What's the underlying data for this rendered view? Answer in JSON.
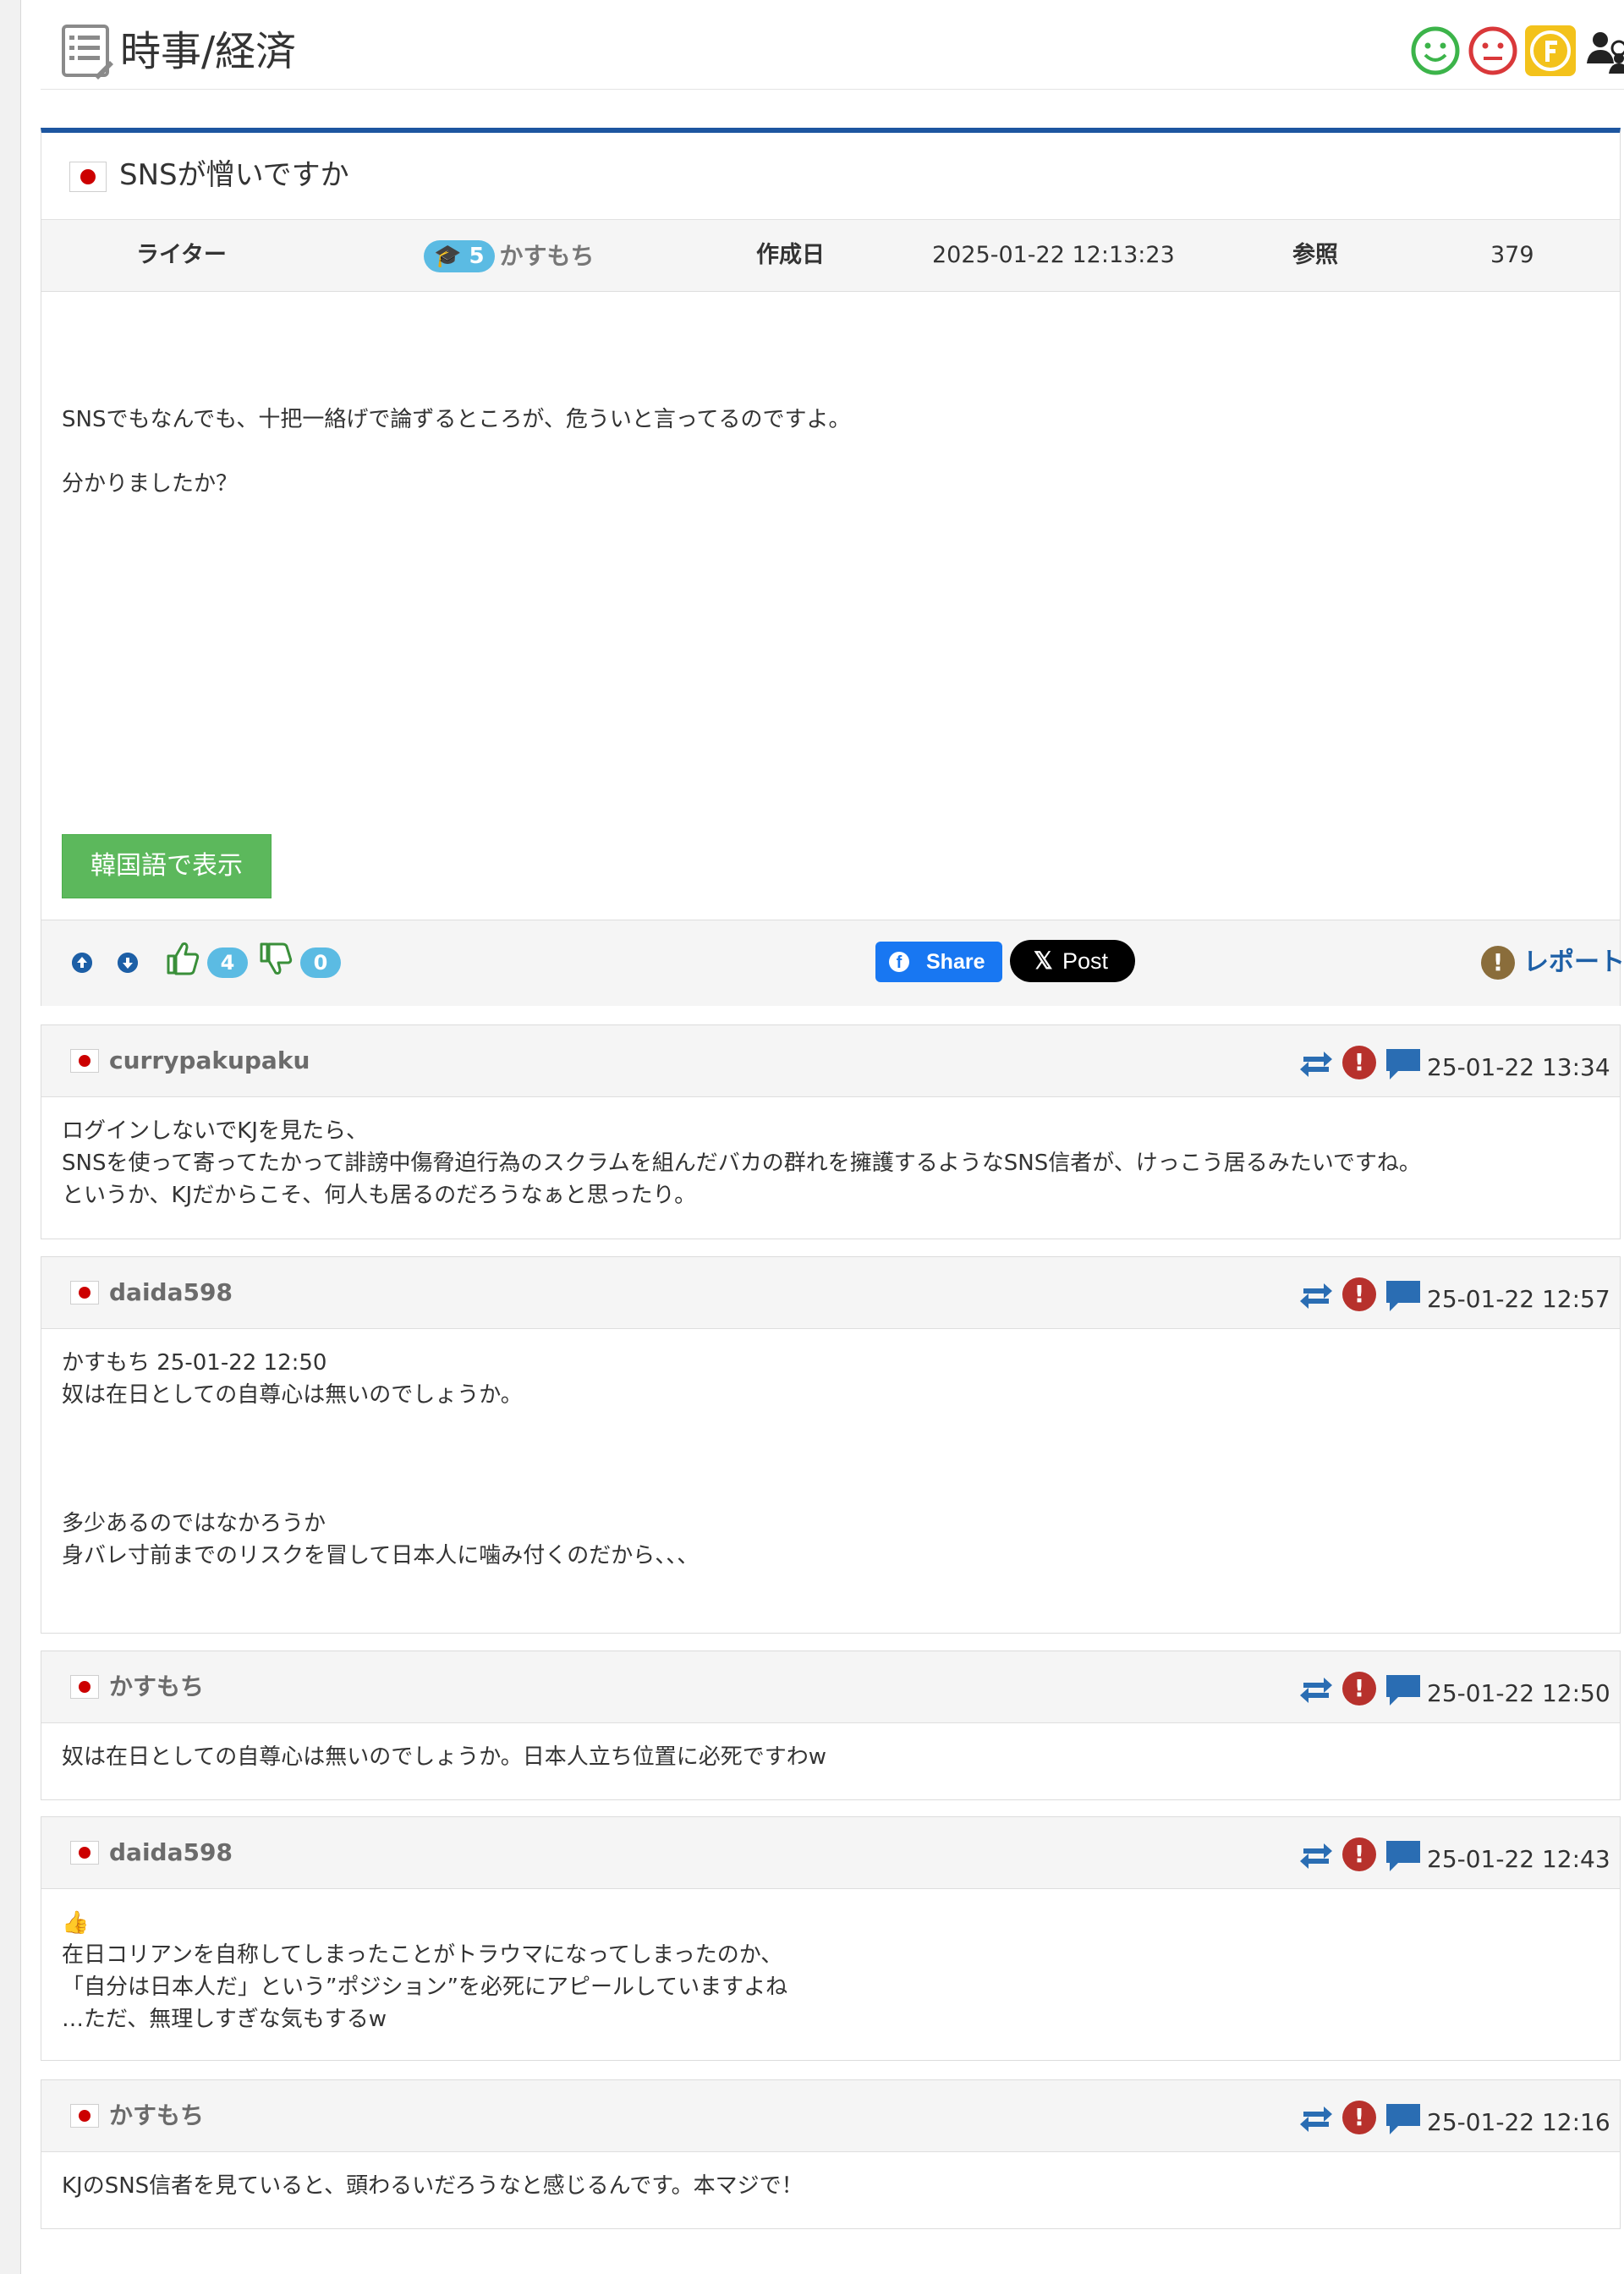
{
  "category": {
    "title": "時事/経済"
  },
  "header_icons": [
    "smile-icon",
    "frown-icon",
    "f-icon",
    "users-icon"
  ],
  "post": {
    "title": "SNSが憎いですか",
    "writer_label": "ライター",
    "writer_level": "5",
    "writer_name": "かすもち",
    "date_label": "作成日",
    "date": "2025-01-22 12:13:23",
    "views_label": "参照",
    "views": "379",
    "body": [
      "SNSでもなんでも、十把一絡げで論ずるところが、危ういと言ってるのですよ。",
      "分かりましたか？"
    ],
    "translate_button": "韓国語で表示",
    "likes": "4",
    "dislikes": "0",
    "share_label": "Share",
    "post_label": "Post",
    "report_label": "レポート"
  },
  "comments": [
    {
      "user": "currypakupaku",
      "date": "25-01-22 13:34",
      "lines": [
        "ログインしないでKJを見たら、",
        "SNSを使って寄ってたかって誹謗中傷脅迫行為のスクラムを組んだバカの群れを擁護するようなSNS信者が、けっこう居るみたいですね。",
        "というか、KJだからこそ、何人も居るのだろうなぁと思ったり。"
      ]
    },
    {
      "user": "daida598",
      "date": "25-01-22 12:57",
      "lines": [
        "かすもち 25-01-22 12:50",
        "奴は在日としての自尊心は無いのでしょうか。",
        "",
        "",
        "",
        "多少あるのではなかろうか",
        "身バレ寸前までのリスクを冒して日本人に噛み付くのだから、、、"
      ]
    },
    {
      "user": "かすもち",
      "date": "25-01-22 12:50",
      "lines": [
        "奴は在日としての自尊心は無いのでしょうか。日本人立ち位置に必死ですわw"
      ]
    },
    {
      "user": "daida598",
      "date": "25-01-22 12:43",
      "lines": [
        "👍",
        "在日コリアンを自称してしまったことがトラウマになってしまったのか、",
        "「自分は日本人だ」という”ポジション”を必死にアピールしていますよね",
        "…ただ、無理しすぎな気もするw"
      ]
    },
    {
      "user": "かすもち",
      "date": "25-01-22 12:16",
      "lines": [
        "KJのSNS信者を見ていると、頭わるいだろうなと感じるんです。本マジで！"
      ]
    }
  ]
}
